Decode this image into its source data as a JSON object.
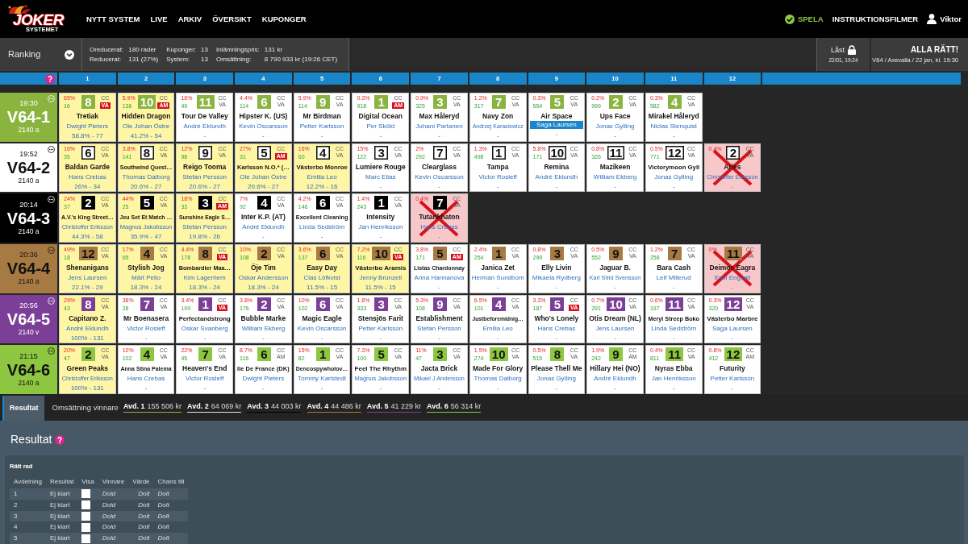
{
  "nav": {
    "logo": {
      "title": "JOKER",
      "subtitle": "SYSTEMET"
    },
    "links": [
      "NYTT SYSTEM",
      "LIVE",
      "ARKIV",
      "ÖVERSIKT",
      "KUPONGER"
    ],
    "play": "SPELA",
    "videos": "INSTRUKTIONSFILMER",
    "user": "Viktor"
  },
  "toolbar": {
    "ranking": "Ranking",
    "summary": [
      [
        {
          "label": "Oreducerat:",
          "value": "180 rader"
        },
        {
          "label": "Reducerat:",
          "value": "131 (27%)"
        }
      ],
      [
        {
          "label": "Kuponger:",
          "value": "13"
        },
        {
          "label": "System:",
          "value": "13"
        }
      ],
      [
        {
          "label": "Inlämningspris:",
          "value": "131 kr"
        },
        {
          "label": "Omsättning:",
          "value": "8 790 933 kr (19:26 CET)"
        }
      ]
    ],
    "lock": {
      "label": "Låst",
      "time": "22/01, 19:24"
    },
    "game": {
      "title": "ALLA RÄTT!",
      "detail": "V64 / Axevalla / 22 jan, kl. 19:30"
    }
  },
  "columns": [
    "1",
    "2",
    "3",
    "4",
    "5",
    "6",
    "7",
    "8",
    "9",
    "10",
    "11",
    "12"
  ],
  "divisions": [
    {
      "time": "19:30",
      "title": "V64-1",
      "distance": "2140 a",
      "color": "#8bb43f",
      "kind": "light",
      "horses": [
        {
          "percent": "65%",
          "count": "16",
          "number": "8",
          "tags": [
            "CC",
            "VA"
          ],
          "flagged": true,
          "name": "Tretiak",
          "driver": "Dwight Pieters",
          "driver_selected": false,
          "note": "58.8% - 77",
          "selected": true,
          "scratched": false
        },
        {
          "percent": "5.9%",
          "count": "136",
          "number": "10",
          "tags": [
            "CC",
            "AM"
          ],
          "flagged": true,
          "name": "Hidden Dragon",
          "driver": "Ole Johan Östre",
          "driver_selected": false,
          "note": "41.2% - 54",
          "selected": true,
          "scratched": false
        },
        {
          "percent": "16%",
          "count": "49",
          "number": "11",
          "tags": [
            "CC",
            "VA"
          ],
          "flagged": false,
          "name": "Tour De Valley",
          "driver": "André Eklundh",
          "driver_selected": false,
          "note": "-",
          "selected": false,
          "scratched": false
        },
        {
          "percent": "4.4%",
          "count": "114",
          "number": "6",
          "tags": [
            "CC",
            "VA"
          ],
          "flagged": false,
          "name": "Hipster K. (US)",
          "driver": "Kevin Oscarsson",
          "driver_selected": false,
          "note": "-",
          "selected": false,
          "scratched": false
        },
        {
          "percent": "5.9%",
          "count": "114",
          "number": "9",
          "tags": [
            "CC",
            "VA"
          ],
          "flagged": false,
          "name": "Mr Birdman",
          "driver": "Petter Karlsson",
          "driver_selected": false,
          "note": "-",
          "selected": false,
          "scratched": false
        },
        {
          "percent": "0.3%",
          "count": "918",
          "number": "1",
          "tags": [
            "CC",
            "AM"
          ],
          "flagged": true,
          "name": "Digital Ocean",
          "driver": "Per Sköld",
          "driver_selected": false,
          "note": "-",
          "selected": false,
          "scratched": false
        },
        {
          "percent": "0.9%",
          "count": "325",
          "number": "3",
          "tags": [
            "CC",
            "VA"
          ],
          "flagged": false,
          "name": "Max Håleryd",
          "driver": "Juhani Partanen",
          "driver_selected": false,
          "note": "-",
          "selected": false,
          "scratched": false
        },
        {
          "percent": "1.2%",
          "count": "317",
          "number": "7",
          "tags": [
            "CC",
            "VA"
          ],
          "flagged": false,
          "name": "Navy Zon",
          "driver": "Andrzej Karasiewicz",
          "driver_selected": false,
          "note": "-",
          "selected": false,
          "scratched": false
        },
        {
          "percent": "0.3%",
          "count": "554",
          "number": "5",
          "tags": [
            "CC",
            "VA"
          ],
          "flagged": false,
          "name": "Air Space",
          "driver": "Saga Laursen",
          "driver_selected": true,
          "note": "-",
          "selected": false,
          "scratched": false
        },
        {
          "percent": "0.2%",
          "count": "999",
          "number": "2",
          "tags": [
            "CC",
            "VA"
          ],
          "flagged": false,
          "name": "Ups Face",
          "driver": "Jonas Gylling",
          "driver_selected": false,
          "note": "-",
          "selected": false,
          "scratched": false
        },
        {
          "percent": "0.3%",
          "count": "582",
          "number": "4",
          "tags": [
            "CC",
            "VA"
          ],
          "flagged": false,
          "name": "Mirakel Håleryd",
          "driver": "Niclas Stenquist",
          "driver_selected": false,
          "note": "-",
          "selected": false,
          "scratched": false
        }
      ]
    },
    {
      "time": "19:52",
      "title": "V64-2",
      "distance": "2140 a",
      "color": "#ffffff",
      "kind": "outlined",
      "horses": [
        {
          "percent": "16%",
          "count": "35",
          "number": "6",
          "tags": [
            "CC",
            "VA"
          ],
          "flagged": false,
          "name": "Baldan Garde",
          "driver": "Hans Crebas",
          "driver_selected": false,
          "note": "26% - 34",
          "selected": true,
          "scratched": false
        },
        {
          "percent": "3.8%",
          "count": "141",
          "number": "8",
          "tags": [
            "CC",
            "VA"
          ],
          "flagged": false,
          "name": "Southwind Quest…",
          "driver": "Thomas Dalborg",
          "driver_selected": false,
          "note": "20.6% - 27",
          "selected": true,
          "scratched": false
        },
        {
          "percent": "12%",
          "count": "98",
          "number": "9",
          "tags": [
            "CC",
            "VA"
          ],
          "flagged": false,
          "name": "Reigo Tooma",
          "driver": "Stefan Persson",
          "driver_selected": false,
          "note": "20.6% - 27",
          "selected": true,
          "scratched": false
        },
        {
          "percent": "27%",
          "count": "31",
          "number": "5",
          "tags": [
            "CC",
            "AM"
          ],
          "flagged": true,
          "name": "Karlsson N.O.* (…",
          "driver": "Ole Johan Östre",
          "driver_selected": false,
          "note": "20.6% - 27",
          "selected": true,
          "scratched": false
        },
        {
          "percent": "16%",
          "count": "60",
          "number": "4",
          "tags": [
            "CC",
            "VA"
          ],
          "flagged": false,
          "name": "Västerbo Monroe",
          "driver": "Emilia Leo",
          "driver_selected": false,
          "note": "12.2% - 16",
          "selected": true,
          "scratched": false
        },
        {
          "percent": "15%",
          "count": "122",
          "number": "3",
          "tags": [
            "CC",
            "VA"
          ],
          "flagged": false,
          "name": "Lumiere Rouge",
          "driver": "Marc Elias",
          "driver_selected": false,
          "note": "-",
          "selected": false,
          "scratched": false
        },
        {
          "percent": "2%",
          "count": "292",
          "number": "7",
          "tags": [
            "CC",
            "VA"
          ],
          "flagged": false,
          "name": "Clearglass",
          "driver": "Kevin Oscarsson",
          "driver_selected": false,
          "note": "-",
          "selected": false,
          "scratched": false
        },
        {
          "percent": "1.3%",
          "count": "498",
          "number": "1",
          "tags": [
            "CC",
            "VA"
          ],
          "flagged": false,
          "name": "Tampa",
          "driver": "Victor Rosleff",
          "driver_selected": false,
          "note": "-",
          "selected": false,
          "scratched": false
        },
        {
          "percent": "5.8%",
          "count": "171",
          "number": "10",
          "tags": [
            "CC",
            "VA"
          ],
          "flagged": false,
          "name": "Remina",
          "driver": "André Eklundh",
          "driver_selected": false,
          "note": "-",
          "selected": false,
          "scratched": false
        },
        {
          "percent": "0.8%",
          "count": "326",
          "number": "11",
          "tags": [
            "CC",
            "VA"
          ],
          "flagged": false,
          "name": "Mazikeen",
          "driver": "William Ekberg",
          "driver_selected": false,
          "note": "-",
          "selected": false,
          "scratched": false
        },
        {
          "percent": "0.5%",
          "count": "771",
          "number": "12",
          "tags": [
            "CC",
            "VA"
          ],
          "flagged": false,
          "name": "Victorymoon Gyll",
          "driver": "Jonas Gylling",
          "driver_selected": false,
          "note": "-",
          "selected": false,
          "scratched": false
        },
        {
          "percent": "0.4%",
          "number": "2",
          "tags": [
            "CC",
            "VA"
          ],
          "flagged": false,
          "name": "Aries",
          "driver": "Christoffer Eriksson",
          "driver_selected": false,
          "note": "-",
          "selected": false,
          "scratched": true
        }
      ]
    },
    {
      "time": "20:14",
      "title": "V64-3",
      "distance": "2140 a",
      "color": "#000000",
      "kind": "light",
      "horses": [
        {
          "percent": "24%",
          "count": "37",
          "number": "2",
          "tags": [
            "CC",
            "VA"
          ],
          "flagged": false,
          "name": "A.V.'s King Street…",
          "driver": "Christoffer Eriksson",
          "driver_selected": false,
          "note": "44.3% - 58",
          "selected": true,
          "scratched": false
        },
        {
          "percent": "44%",
          "count": "25",
          "number": "5",
          "tags": [
            "CC",
            "VA"
          ],
          "flagged": false,
          "name": "Jeu Set Et Match …",
          "driver": "Magnus Jakobsson",
          "driver_selected": false,
          "note": "35.9% - 47",
          "selected": true,
          "scratched": false
        },
        {
          "percent": "18%",
          "count": "33",
          "number": "3",
          "tags": [
            "CC",
            "AM"
          ],
          "flagged": true,
          "name": "Sunshine Eagle S…",
          "driver": "Stefan Persson",
          "driver_selected": false,
          "note": "19.8% - 26",
          "selected": true,
          "scratched": false
        },
        {
          "percent": "7%",
          "count": "92",
          "number": "4",
          "tags": [
            "CC",
            "VA"
          ],
          "flagged": false,
          "name": "Inter K.P. (AT)",
          "driver": "André Eklundh",
          "driver_selected": false,
          "note": "-",
          "selected": false,
          "scratched": false
        },
        {
          "percent": "4.2%",
          "count": "146",
          "number": "6",
          "tags": [
            "CC",
            "VA"
          ],
          "flagged": false,
          "name": "Excellent Cleaning",
          "driver": "Linda Sedström",
          "driver_selected": false,
          "note": "-",
          "selected": false,
          "scratched": false
        },
        {
          "percent": "1.4%",
          "count": "243",
          "number": "1",
          "tags": [
            "CC",
            "VA"
          ],
          "flagged": false,
          "name": "Intensity",
          "driver": "Jan Henriksson",
          "driver_selected": false,
          "note": "-",
          "selected": false,
          "scratched": false
        },
        {
          "percent": "0.4%",
          "number": "7",
          "tags": [
            "CC",
            "VA"
          ],
          "flagged": false,
          "name": "Tutankhaton",
          "driver": "Hans Crebas",
          "driver_selected": false,
          "note": "-",
          "selected": false,
          "scratched": true
        }
      ]
    },
    {
      "time": "20:36",
      "title": "V64-4",
      "distance": "2140 a",
      "color": "#a87a43",
      "kind": "dark",
      "horses": [
        {
          "percent": "49%",
          "count": "18",
          "number": "12",
          "tags": [
            "CC",
            "VA"
          ],
          "flagged": false,
          "name": "Shenanigans",
          "driver": "Jens Laursen",
          "driver_selected": false,
          "note": "22.1% - 29",
          "selected": true,
          "scratched": false
        },
        {
          "percent": "17%",
          "count": "65",
          "number": "4",
          "tags": [
            "CC",
            "VA"
          ],
          "flagged": false,
          "name": "Stylish Jog",
          "driver": "Märt Pello",
          "driver_selected": false,
          "note": "18.3% - 24",
          "selected": true,
          "scratched": false
        },
        {
          "percent": "4.4%",
          "count": "178",
          "number": "8",
          "tags": [
            "CC",
            "VA"
          ],
          "flagged": true,
          "name": "Bombardier Maa…",
          "driver": "Kim Lagerhem",
          "driver_selected": false,
          "note": "18.3% - 24",
          "selected": true,
          "scratched": false
        },
        {
          "percent": "10%",
          "count": "108",
          "number": "2",
          "tags": [
            "CC",
            "VA"
          ],
          "flagged": false,
          "name": "Öje Tim",
          "driver": "Oskar Andersson",
          "driver_selected": false,
          "note": "18.3% - 24",
          "selected": true,
          "scratched": false
        },
        {
          "percent": "3.6%",
          "count": "137",
          "number": "6",
          "tags": [
            "CC",
            "VA"
          ],
          "flagged": false,
          "name": "Easy Day",
          "driver": "Clas Löfkvist",
          "driver_selected": false,
          "note": "11.5% - 15",
          "selected": true,
          "scratched": false
        },
        {
          "percent": "7.2%",
          "count": "116",
          "number": "10",
          "tags": [
            "CC",
            "VA"
          ],
          "flagged": true,
          "name": "Västerbo Aramis",
          "driver": "Jenny Brunzell",
          "driver_selected": false,
          "note": "11.5% - 15",
          "selected": true,
          "scratched": false
        },
        {
          "percent": "3.8%",
          "count": "171",
          "number": "5",
          "tags": [
            "CC",
            "AM"
          ],
          "flagged": true,
          "name": "Listas Chardonnay",
          "driver": "Anna Hannanova",
          "driver_selected": false,
          "note": "-",
          "selected": false,
          "scratched": false
        },
        {
          "percent": "2.4%",
          "count": "254",
          "number": "1",
          "tags": [
            "CC",
            "VA"
          ],
          "flagged": false,
          "name": "Janica Zet",
          "driver": "Herman Sundbom",
          "driver_selected": false,
          "note": "-",
          "selected": false,
          "scratched": false
        },
        {
          "percent": "0.8%",
          "count": "299",
          "number": "3",
          "tags": [
            "CC",
            "VA"
          ],
          "flagged": false,
          "name": "Elly Livin",
          "driver": "Mikaela Rydberg",
          "driver_selected": false,
          "note": "-",
          "selected": false,
          "scratched": false
        },
        {
          "percent": "0.5%",
          "count": "552",
          "number": "9",
          "tags": [
            "CC",
            "VA"
          ],
          "flagged": false,
          "name": "Jaguar B.",
          "driver": "Karl Strid Svensson",
          "driver_selected": false,
          "note": "-",
          "selected": false,
          "scratched": false
        },
        {
          "percent": "1.2%",
          "count": "258",
          "number": "7",
          "tags": [
            "CC",
            "VA"
          ],
          "flagged": false,
          "name": "Bara Cash",
          "driver": "Leif Millerud",
          "driver_selected": false,
          "note": "-",
          "selected": false,
          "scratched": false
        },
        {
          "percent": "0%",
          "number": "11",
          "tags": [
            "CC",
            "VA"
          ],
          "flagged": false,
          "name": "Deimos Eagra",
          "driver": "Emil Engvall",
          "driver_selected": false,
          "note": "-",
          "selected": false,
          "scratched": true
        }
      ]
    },
    {
      "time": "20:56",
      "title": "V64-5",
      "distance": "2140 v",
      "color": "#7b3f97",
      "kind": "light",
      "horses": [
        {
          "percent": "29%",
          "count": "43",
          "number": "8",
          "tags": [
            "CC",
            "VA"
          ],
          "flagged": false,
          "name": "Capitano Z.",
          "driver": "André Eklundh",
          "driver_selected": false,
          "note": "100% - 131",
          "selected": true,
          "scratched": false
        },
        {
          "percent": "36%",
          "count": "28",
          "number": "7",
          "tags": [
            "CC",
            "VA"
          ],
          "flagged": false,
          "name": "Mr Boenasera",
          "driver": "Victor Rosleff",
          "driver_selected": false,
          "note": "-",
          "selected": false,
          "scratched": false
        },
        {
          "percent": "3.4%",
          "count": "199",
          "number": "1",
          "tags": [
            "CC",
            "VA"
          ],
          "flagged": true,
          "name": "Perfectandstrong",
          "driver": "Oskar Svanberg",
          "driver_selected": false,
          "note": "-",
          "selected": false,
          "scratched": false
        },
        {
          "percent": "3.8%",
          "count": "176",
          "number": "2",
          "tags": [
            "CC",
            "VA"
          ],
          "flagged": false,
          "name": "Bubble Marke",
          "driver": "William Ekberg",
          "driver_selected": false,
          "note": "-",
          "selected": false,
          "scratched": false
        },
        {
          "percent": "10%",
          "count": "102",
          "number": "6",
          "tags": [
            "CC",
            "VA"
          ],
          "flagged": false,
          "name": "Magic Eagle",
          "driver": "Kevin Oscarsson",
          "driver_selected": false,
          "note": "-",
          "selected": false,
          "scratched": false
        },
        {
          "percent": "1.8%",
          "count": "333",
          "number": "3",
          "tags": [
            "CC",
            "VA"
          ],
          "flagged": false,
          "name": "Stensjös Farit",
          "driver": "Petter Karlsson",
          "driver_selected": false,
          "note": "-",
          "selected": false,
          "scratched": false
        },
        {
          "percent": "5.3%",
          "count": "108",
          "number": "9",
          "tags": [
            "CC",
            "VA"
          ],
          "flagged": false,
          "name": "Establishment",
          "driver": "Stefan Persson",
          "driver_selected": false,
          "note": "-",
          "selected": false,
          "scratched": false
        },
        {
          "percent": "6.5%",
          "count": "101",
          "number": "4",
          "tags": [
            "CC",
            "VA"
          ],
          "flagged": false,
          "name": "Justbeforemidnig…",
          "driver": "Emilia Leo",
          "driver_selected": false,
          "note": "-",
          "selected": false,
          "scratched": false
        },
        {
          "percent": "3.3%",
          "count": "187",
          "number": "5",
          "tags": [
            "CC",
            "VA"
          ],
          "flagged": true,
          "name": "Who's Lonely",
          "driver": "Hans Crebas",
          "driver_selected": false,
          "note": "-",
          "selected": false,
          "scratched": false
        },
        {
          "percent": "0.7%",
          "count": "291",
          "number": "10",
          "tags": [
            "CC",
            "VA"
          ],
          "flagged": false,
          "name": "Otis Dream (NL)",
          "driver": "Jens Laursen",
          "driver_selected": false,
          "note": "-",
          "selected": false,
          "scratched": false
        },
        {
          "percent": "0.6%",
          "count": "197",
          "number": "11",
          "tags": [
            "CC",
            "VA"
          ],
          "flagged": false,
          "name": "Meryl Streep Boko",
          "driver": "Linda Sedström",
          "driver_selected": false,
          "note": "-",
          "selected": false,
          "scratched": false
        },
        {
          "percent": "0.3%",
          "count": "320",
          "number": "12",
          "tags": [
            "CC",
            "VA"
          ],
          "flagged": false,
          "name": "Västerbo Marbre",
          "driver": "Saga Laursen",
          "driver_selected": false,
          "note": "-",
          "selected": false,
          "scratched": false
        }
      ]
    },
    {
      "time": "21:15",
      "title": "V64-6",
      "distance": "2140 a",
      "color": "#8dc641",
      "kind": "dark",
      "horses": [
        {
          "percent": "20%",
          "count": "47",
          "number": "2",
          "tags": [
            "CC",
            "VA"
          ],
          "flagged": false,
          "name": "Green Peaks",
          "driver": "Christoffer Eriksson",
          "driver_selected": false,
          "note": "100% - 131",
          "selected": true,
          "scratched": false
        },
        {
          "percent": "10%",
          "count": "102",
          "number": "4",
          "tags": [
            "CC",
            "VA"
          ],
          "flagged": false,
          "name": "Anna Stina Palema",
          "driver": "Hans Crebas",
          "driver_selected": false,
          "note": "-",
          "selected": false,
          "scratched": false
        },
        {
          "percent": "22%",
          "count": "45",
          "number": "7",
          "tags": [
            "CC",
            "VA"
          ],
          "flagged": false,
          "name": "Heaven's End",
          "driver": "Victor Rosleff",
          "driver_selected": false,
          "note": "-",
          "selected": false,
          "scratched": false
        },
        {
          "percent": "8.7%",
          "count": "116",
          "number": "6",
          "tags": [
            "CC",
            "AM"
          ],
          "flagged": false,
          "name": "Ile De France (DK)",
          "driver": "Dwight Pieters",
          "driver_selected": false,
          "note": "-",
          "selected": false,
          "scratched": false
        },
        {
          "percent": "15%",
          "count": "82",
          "number": "1",
          "tags": [
            "CC",
            "VA"
          ],
          "flagged": false,
          "name": "Dencospywholov…",
          "driver": "Tommy Karlstedt",
          "driver_selected": false,
          "note": "-",
          "selected": false,
          "scratched": false
        },
        {
          "percent": "7.3%",
          "count": "100",
          "number": "5",
          "tags": [
            "CC",
            "VA"
          ],
          "flagged": false,
          "name": "Feel The Rhythm",
          "driver": "Magnus Jakobsson",
          "driver_selected": false,
          "note": "-",
          "selected": false,
          "scratched": false
        },
        {
          "percent": "11%",
          "count": "47",
          "number": "3",
          "tags": [
            "CC",
            "VA"
          ],
          "flagged": false,
          "name": "Jacta Brick",
          "driver": "Mikael J Andersson",
          "driver_selected": false,
          "note": "-",
          "selected": false,
          "scratched": false
        },
        {
          "percent": "1.5%",
          "count": "274",
          "number": "10",
          "tags": [
            "CC",
            "VA"
          ],
          "flagged": false,
          "name": "Made For Glory",
          "driver": "Thomas Dalborg",
          "driver_selected": false,
          "note": "-",
          "selected": false,
          "scratched": false
        },
        {
          "percent": "0.5%",
          "count": "515",
          "number": "8",
          "tags": [
            "CC",
            "VA"
          ],
          "flagged": false,
          "name": "Please Thell Me",
          "driver": "Jonas Gylling",
          "driver_selected": false,
          "note": "-",
          "selected": false,
          "scratched": false
        },
        {
          "percent": "1.9%",
          "count": "242",
          "number": "9",
          "tags": [
            "CC",
            "AM"
          ],
          "flagged": false,
          "name": "Hillary Hei (NO)",
          "driver": "André Eklundh",
          "driver_selected": false,
          "note": "-",
          "selected": false,
          "scratched": false
        },
        {
          "percent": "0.4%",
          "count": "811",
          "number": "11",
          "tags": [
            "CC",
            "VA"
          ],
          "flagged": false,
          "name": "Nyras Ebba",
          "driver": "Jan Henriksson",
          "driver_selected": false,
          "note": "-",
          "selected": false,
          "scratched": false
        },
        {
          "percent": "0.8%",
          "count": "412",
          "number": "12",
          "tags": [
            "CC",
            "AM"
          ],
          "flagged": false,
          "name": "Futurity",
          "driver": "Petter Karlsson",
          "driver_selected": false,
          "note": "-",
          "selected": false,
          "scratched": false
        }
      ]
    }
  ],
  "results_bar": {
    "tabs": [
      {
        "label": "Resultat",
        "selected": true
      }
    ],
    "turnover_label": "Omsättning vinnare",
    "turnover": [
      {
        "division": "Avd. 1",
        "amount": "155 506 kr",
        "color": "#8bb43f"
      },
      {
        "division": "Avd. 2",
        "amount": "64 069 kr",
        "color": "#e6e6e6"
      },
      {
        "division": "Avd. 3",
        "amount": "44 003 kr",
        "color": "#000000"
      },
      {
        "division": "Avd. 4",
        "amount": "44 486 kr",
        "color": "#a87a43"
      },
      {
        "division": "Avd. 5",
        "amount": "41 229 kr",
        "color": "#7b3f97"
      },
      {
        "division": "Avd. 6",
        "amount": "56 314 kr",
        "color": "#8dc641"
      }
    ]
  },
  "results": {
    "title": "Resultat",
    "subtitle": "Rätt rad",
    "columns": [
      "Avdelning",
      "Resultat",
      "Visa",
      "Vinnare",
      "Värde",
      "Chans till"
    ],
    "rows": [
      {
        "division": "1",
        "result": "Ej klart",
        "show": false,
        "winner": "Dold",
        "value": "Dolt",
        "chance": "Dolt"
      },
      {
        "division": "2",
        "result": "Ej klart",
        "show": false,
        "winner": "Dold",
        "value": "Dolt",
        "chance": "Dolt"
      },
      {
        "division": "3",
        "result": "Ej klart",
        "show": false,
        "winner": "Dold",
        "value": "Dolt",
        "chance": "Dolt"
      },
      {
        "division": "4",
        "result": "Ej klart",
        "show": false,
        "winner": "Dold",
        "value": "Dolt",
        "chance": "Dolt"
      },
      {
        "division": "5",
        "result": "Ej klart",
        "show": false,
        "winner": "Dold",
        "value": "Dolt",
        "chance": "Dolt"
      }
    ]
  }
}
